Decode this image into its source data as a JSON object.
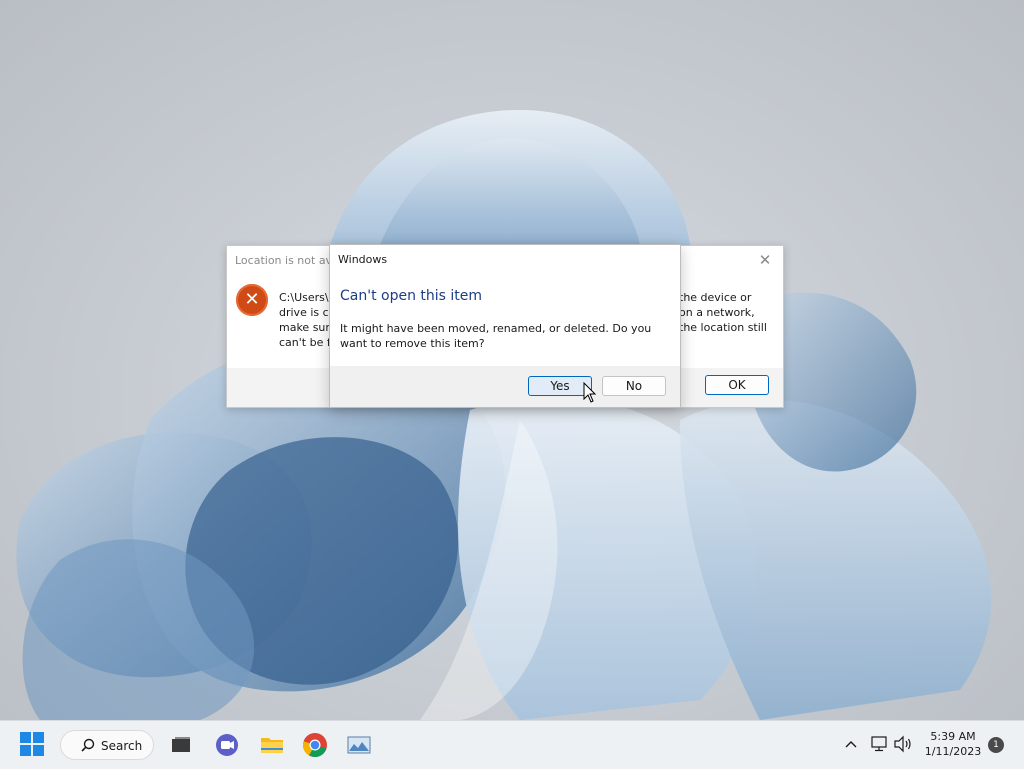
{
  "back_dialog": {
    "title": "Location is not ava",
    "message_left": "C:\\Users\\\ndrive is co\nmake sure\ncan't be fo",
    "message_right": "the device or\non a network,\nthe location still",
    "ok_label": "OK",
    "icon": "error-x-icon",
    "close_icon": "close-icon"
  },
  "front_dialog": {
    "title": "Windows",
    "heading": "Can't open this item",
    "body": "It might have been moved, renamed, or deleted. Do you want to remove this item?",
    "yes_label": "Yes",
    "no_label": "No"
  },
  "taskbar": {
    "search_label": "Search",
    "apps": [
      "start-icon",
      "task-view-icon",
      "chat-icon",
      "file-explorer-icon",
      "chrome-icon",
      "photos-icon"
    ],
    "tray": {
      "time": "5:39 AM",
      "date": "1/11/2023",
      "notification_count": "1",
      "icons": [
        "chevron-up-icon",
        "network-icon",
        "volume-icon"
      ]
    }
  },
  "colors": {
    "accent": "#0067c0",
    "heading_blue": "#1d3e85",
    "error_orange": "#d04a16"
  }
}
